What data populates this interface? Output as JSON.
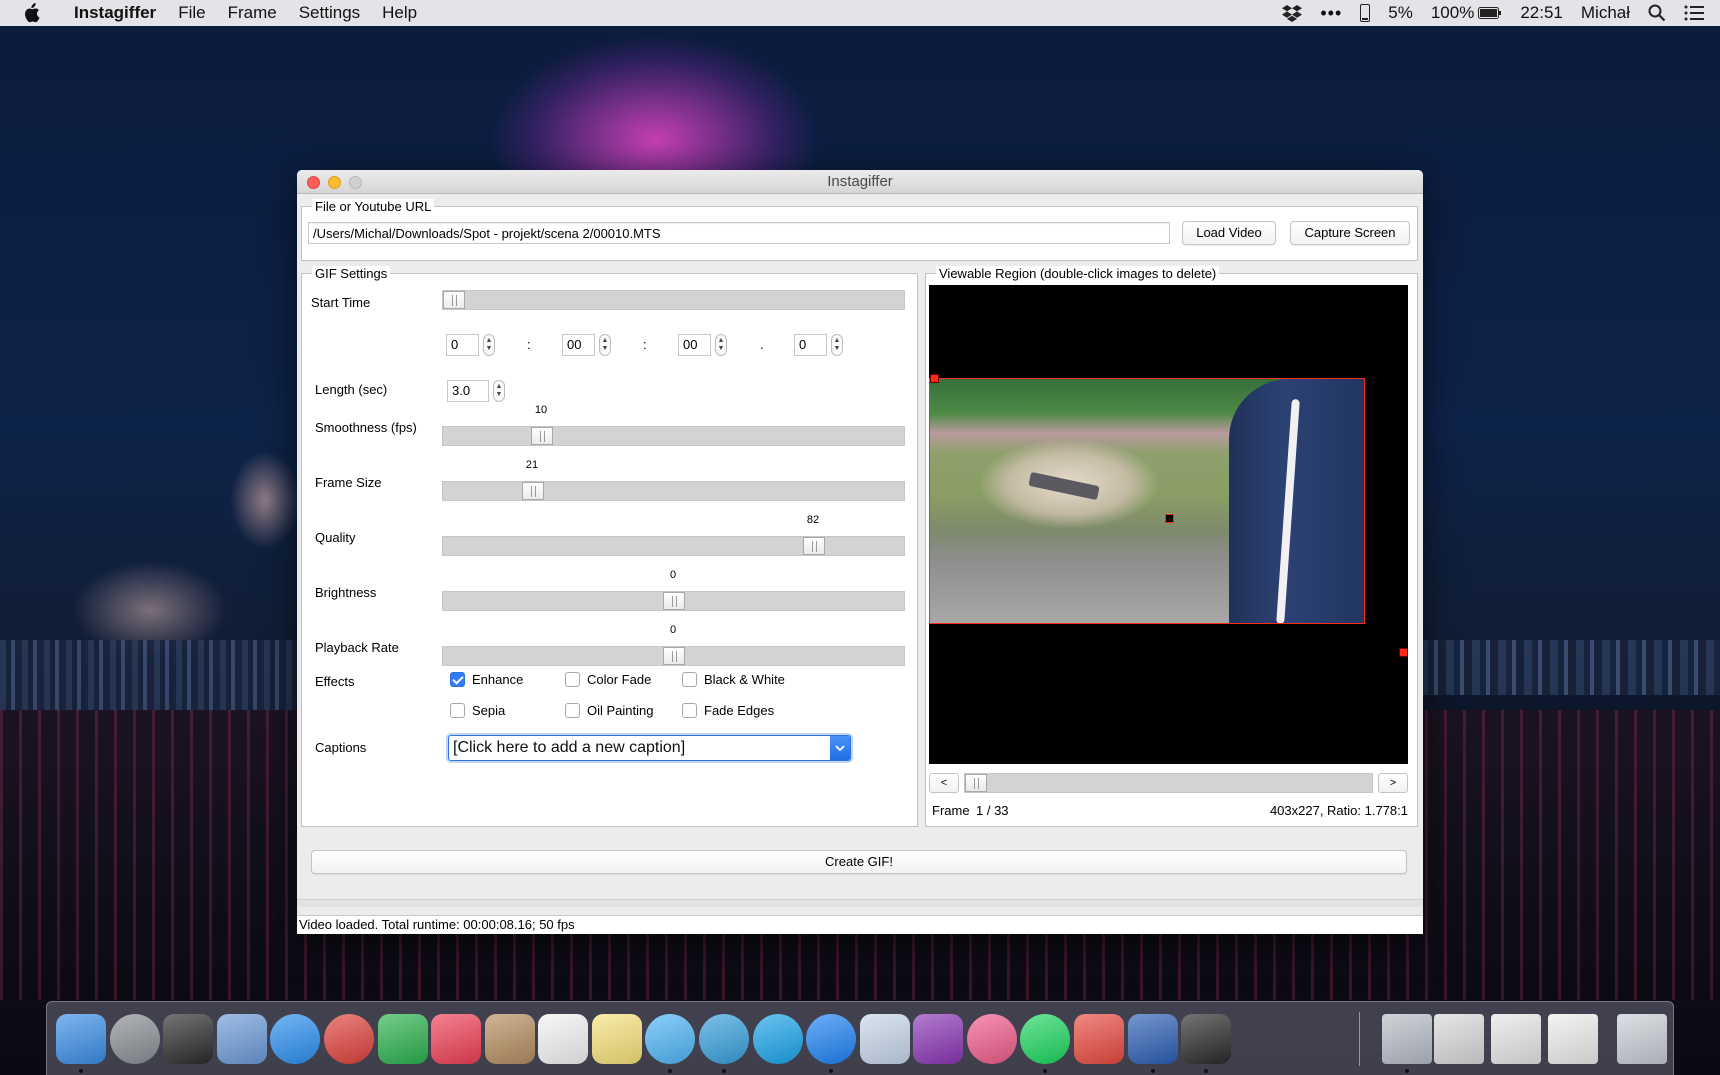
{
  "menubar": {
    "app_name": "Instagiffer",
    "menus": [
      "File",
      "Frame",
      "Settings",
      "Help"
    ],
    "status": {
      "cpu": "5%",
      "battery": "100%",
      "clock": "22:51",
      "user": "Michał"
    }
  },
  "window": {
    "title": "Instagiffer",
    "file_group": {
      "legend": "File or Youtube URL",
      "path_value": "/Users/Michal/Downloads/Spot - projekt/scena 2/00010.MTS",
      "load_button": "Load Video",
      "capture_button": "Capture Screen"
    },
    "gif_settings": {
      "legend": "GIF Settings",
      "start_time_label": "Start Time",
      "start_time_position": 0.0,
      "time_fields": [
        "0",
        "00",
        "00",
        "0"
      ],
      "time_separators": [
        ":",
        ":",
        "."
      ],
      "length_label": "Length (sec)",
      "length_value": "3.0",
      "sliders": [
        {
          "label": "Smoothness (fps)",
          "value": "10",
          "position": 0.2
        },
        {
          "label": "Frame Size",
          "value": "21",
          "position": 0.18
        },
        {
          "label": "Quality",
          "value": "82",
          "position": 0.82
        },
        {
          "label": "Brightness",
          "value": "0",
          "position": 0.5
        },
        {
          "label": "Playback Rate",
          "value": "0",
          "position": 0.5
        }
      ],
      "effects_label": "Effects",
      "effects": [
        {
          "label": "Enhance",
          "checked": true
        },
        {
          "label": "Color Fade",
          "checked": false
        },
        {
          "label": "Black & White",
          "checked": false
        },
        {
          "label": "Sepia",
          "checked": false
        },
        {
          "label": "Oil Painting",
          "checked": false
        },
        {
          "label": "Fade Edges",
          "checked": false
        }
      ],
      "captions_label": "Captions",
      "captions_value": "[Click here to add a new caption]"
    },
    "viewable_region": {
      "legend": "Viewable Region (double-click images to delete)",
      "prev_button": "<",
      "next_button": ">",
      "frame_label": "Frame",
      "frame_counter": "1 / 33",
      "frame_position": 0.0,
      "dimensions": "403x227, Ratio: 1.778:1"
    },
    "create_button": "Create GIF!",
    "status_text": "Video loaded. Total runtime: 00:00:08.16; 50 fps"
  },
  "dock": {
    "apps": [
      {
        "icon": "finder-icon",
        "color": "#3a8ee6"
      },
      {
        "icon": "launchpad-icon",
        "color": "#8a8d94"
      },
      {
        "icon": "photo-booth-icon",
        "color": "#2b2b2b"
      },
      {
        "icon": "mail-icon",
        "color": "#6c9bd8"
      },
      {
        "icon": "safari-icon",
        "color": "#2b8ff0"
      },
      {
        "icon": "chrome-icon",
        "color": "#e0413a"
      },
      {
        "icon": "feedly-icon",
        "color": "#2bb24c"
      },
      {
        "icon": "pocket-icon",
        "color": "#ef3f56"
      },
      {
        "icon": "contacts-icon",
        "color": "#b58d5f"
      },
      {
        "icon": "calendar-icon",
        "color": "#f4f4f4"
      },
      {
        "icon": "notes-icon",
        "color": "#f7e27a"
      },
      {
        "icon": "messages-icon",
        "color": "#4fb6f7"
      },
      {
        "icon": "telegram-icon",
        "color": "#37a0dd"
      },
      {
        "icon": "skype-icon",
        "color": "#1aa5eb"
      },
      {
        "icon": "messenger-icon",
        "color": "#1f83f5"
      },
      {
        "icon": "preview-icon",
        "color": "#c7d7ea"
      },
      {
        "icon": "onenote-icon",
        "color": "#8a36b6"
      },
      {
        "icon": "itunes-icon",
        "color": "#f05b8b"
      },
      {
        "icon": "spotify-icon",
        "color": "#1ed760"
      },
      {
        "icon": "transmit-icon",
        "color": "#e84a3f"
      },
      {
        "icon": "word-icon",
        "color": "#2b5fb5"
      },
      {
        "icon": "instapaper-icon",
        "color": "#2a2a2a"
      },
      {
        "icon": "downloads-folder-icon",
        "color": "#b7bcc6"
      },
      {
        "icon": "document-stack-icon",
        "color": "#d9d9d9"
      },
      {
        "icon": "document-stack-icon",
        "color": "#e6e6e6"
      },
      {
        "icon": "document-stack-icon",
        "color": "#ededed"
      },
      {
        "icon": "trash-icon",
        "color": "#c9cdd4"
      }
    ]
  }
}
